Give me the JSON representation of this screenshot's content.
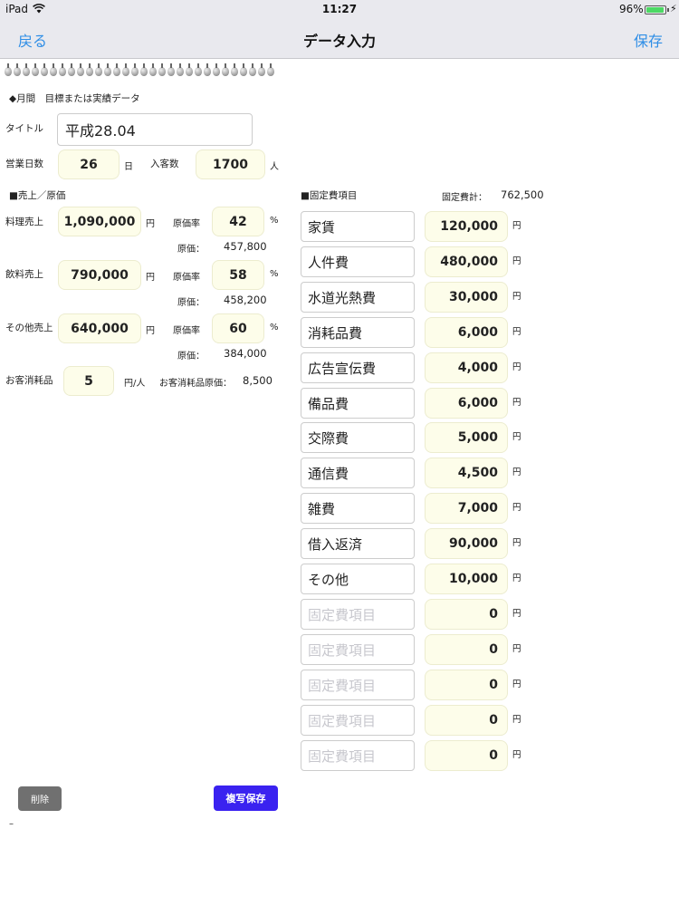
{
  "status": {
    "carrier": "iPad",
    "time": "11:27",
    "battery": "96%",
    "battery_level": 0.96
  },
  "nav": {
    "back": "戻る",
    "title": "データ入力",
    "save": "保存"
  },
  "header": {
    "period_label": "◆月間　目標または実績データ"
  },
  "title_field": {
    "label": "タイトル",
    "value": "平成28.04"
  },
  "business_days": {
    "label": "営業日数",
    "value": "26",
    "unit": "日"
  },
  "customers": {
    "label": "入客数",
    "value": "1700",
    "unit": "人"
  },
  "sales_section": {
    "title": "■売上／原価"
  },
  "sales": [
    {
      "label": "料理売上",
      "value": "1,090,000",
      "unit": "円",
      "rate_label": "原価率",
      "rate": "42",
      "rate_unit": "%",
      "cost_label": "原価：",
      "cost": "457,800"
    },
    {
      "label": "飲料売上",
      "value": "790,000",
      "unit": "円",
      "rate_label": "原価率",
      "rate": "58",
      "rate_unit": "%",
      "cost_label": "原価：",
      "cost": "458,200"
    },
    {
      "label": "その他売上",
      "value": "640,000",
      "unit": "円",
      "rate_label": "原価率",
      "rate": "60",
      "rate_unit": "%",
      "cost_label": "原価：",
      "cost": "384,000"
    }
  ],
  "consumables": {
    "label": "お客消耗品",
    "value": "5",
    "unit": "円/人",
    "cost_label": "お客消耗品原価：",
    "cost": "8,500"
  },
  "fixed_section": {
    "title": "■固定費項目",
    "total_label": "固定費計：",
    "total": "762,500"
  },
  "fixed_items": [
    {
      "name": "家賃",
      "amount": "120,000",
      "unit": "円"
    },
    {
      "name": "人件費",
      "amount": "480,000",
      "unit": "円"
    },
    {
      "name": "水道光熱費",
      "amount": "30,000",
      "unit": "円"
    },
    {
      "name": "消耗品費",
      "amount": "6,000",
      "unit": "円"
    },
    {
      "name": "広告宣伝費",
      "amount": "4,000",
      "unit": "円"
    },
    {
      "name": "備品費",
      "amount": "6,000",
      "unit": "円"
    },
    {
      "name": "交際費",
      "amount": "5,000",
      "unit": "円"
    },
    {
      "name": "通信費",
      "amount": "4,500",
      "unit": "円"
    },
    {
      "name": "雑費",
      "amount": "7,000",
      "unit": "円"
    },
    {
      "name": "借入返済",
      "amount": "90,000",
      "unit": "円"
    },
    {
      "name": "その他",
      "amount": "10,000",
      "unit": "円"
    }
  ],
  "fixed_placeholders": [
    {
      "placeholder": "固定費項目",
      "amount": "0",
      "unit": "円"
    },
    {
      "placeholder": "固定費項目",
      "amount": "0",
      "unit": "円"
    },
    {
      "placeholder": "固定費項目",
      "amount": "0",
      "unit": "円"
    },
    {
      "placeholder": "固定費項目",
      "amount": "0",
      "unit": "円"
    },
    {
      "placeholder": "固定費項目",
      "amount": "0",
      "unit": "円"
    }
  ],
  "buttons": {
    "delete": "削除",
    "copy_save": "複写保存"
  },
  "footer": {
    "dash": "–"
  },
  "colors": {
    "accent": "#2f8ee6",
    "field_bg": "#fdfdea",
    "copy_button": "#3a22f0",
    "delete_button": "#707070"
  }
}
